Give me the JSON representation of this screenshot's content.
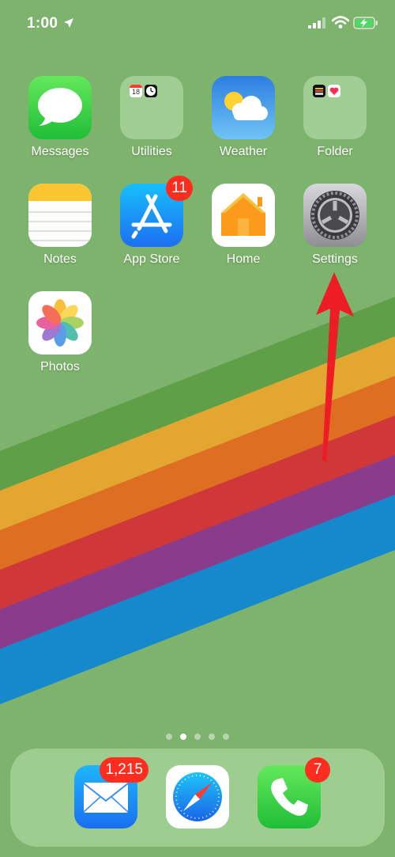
{
  "status_bar": {
    "time": "1:00"
  },
  "home_apps": [
    {
      "label": "Messages"
    },
    {
      "label": "Utilities",
      "folder_mini_label": "18"
    },
    {
      "label": "Weather"
    },
    {
      "label": "Folder"
    },
    {
      "label": "Notes"
    },
    {
      "label": "App Store",
      "badge": "11"
    },
    {
      "label": "Home"
    },
    {
      "label": "Settings"
    },
    {
      "label": "Photos"
    }
  ],
  "page_dots": {
    "count": 5,
    "active_index": 1
  },
  "dock": [
    {
      "name": "Mail",
      "badge": "1,215"
    },
    {
      "name": "Safari"
    },
    {
      "name": "Phone",
      "badge": "7"
    }
  ],
  "colors": {
    "badge": "#ff2d20",
    "arrow": "#ee1c24",
    "wallpaper": "#7db36c"
  }
}
